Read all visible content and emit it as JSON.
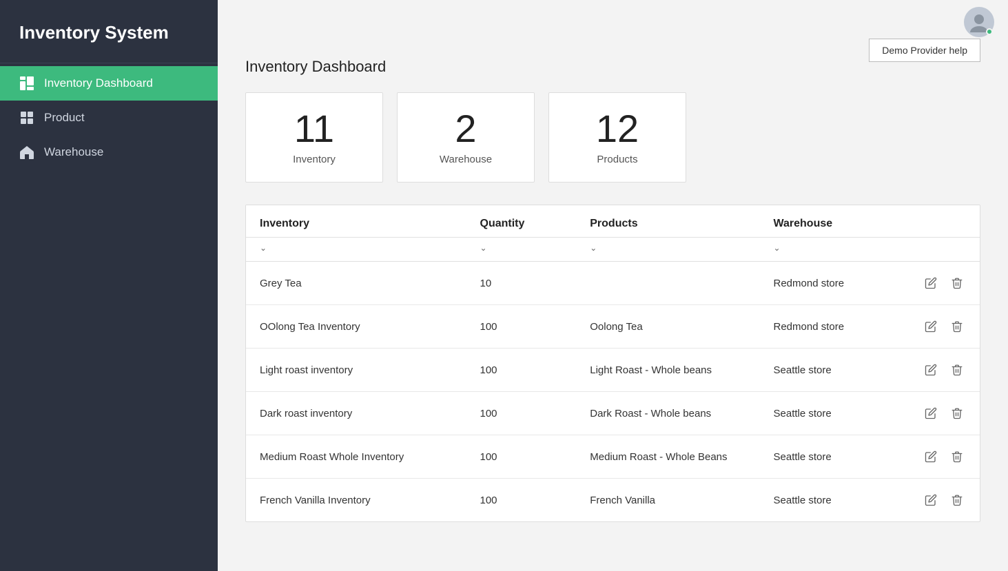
{
  "app": {
    "title": "Inventory System"
  },
  "sidebar": {
    "items": [
      {
        "id": "dashboard",
        "label": "Inventory Dashboard",
        "active": true
      },
      {
        "id": "product",
        "label": "Product",
        "active": false
      },
      {
        "id": "warehouse",
        "label": "Warehouse",
        "active": false
      }
    ]
  },
  "header": {
    "demo_help_label": "Demo Provider help"
  },
  "dashboard": {
    "page_title": "Inventory Dashboard",
    "stats": [
      {
        "number": "11",
        "label": "Inventory"
      },
      {
        "number": "2",
        "label": "Warehouse"
      },
      {
        "number": "12",
        "label": "Products"
      }
    ],
    "table": {
      "columns": [
        {
          "id": "inventory",
          "label": "Inventory"
        },
        {
          "id": "quantity",
          "label": "Quantity"
        },
        {
          "id": "products",
          "label": "Products"
        },
        {
          "id": "warehouse",
          "label": "Warehouse"
        }
      ],
      "rows": [
        {
          "inventory": "Grey Tea",
          "quantity": "10",
          "products": "",
          "warehouse": "Redmond store"
        },
        {
          "inventory": "OOlong Tea Inventory",
          "quantity": "100",
          "products": "Oolong Tea",
          "warehouse": "Redmond store"
        },
        {
          "inventory": "Light roast inventory",
          "quantity": "100",
          "products": "Light Roast - Whole beans",
          "warehouse": "Seattle store"
        },
        {
          "inventory": "Dark roast inventory",
          "quantity": "100",
          "products": "Dark Roast - Whole beans",
          "warehouse": "Seattle store"
        },
        {
          "inventory": "Medium Roast Whole Inventory",
          "quantity": "100",
          "products": "Medium Roast - Whole Beans",
          "warehouse": "Seattle store"
        },
        {
          "inventory": "French Vanilla Inventory",
          "quantity": "100",
          "products": "French Vanilla",
          "warehouse": "Seattle store"
        }
      ]
    }
  }
}
